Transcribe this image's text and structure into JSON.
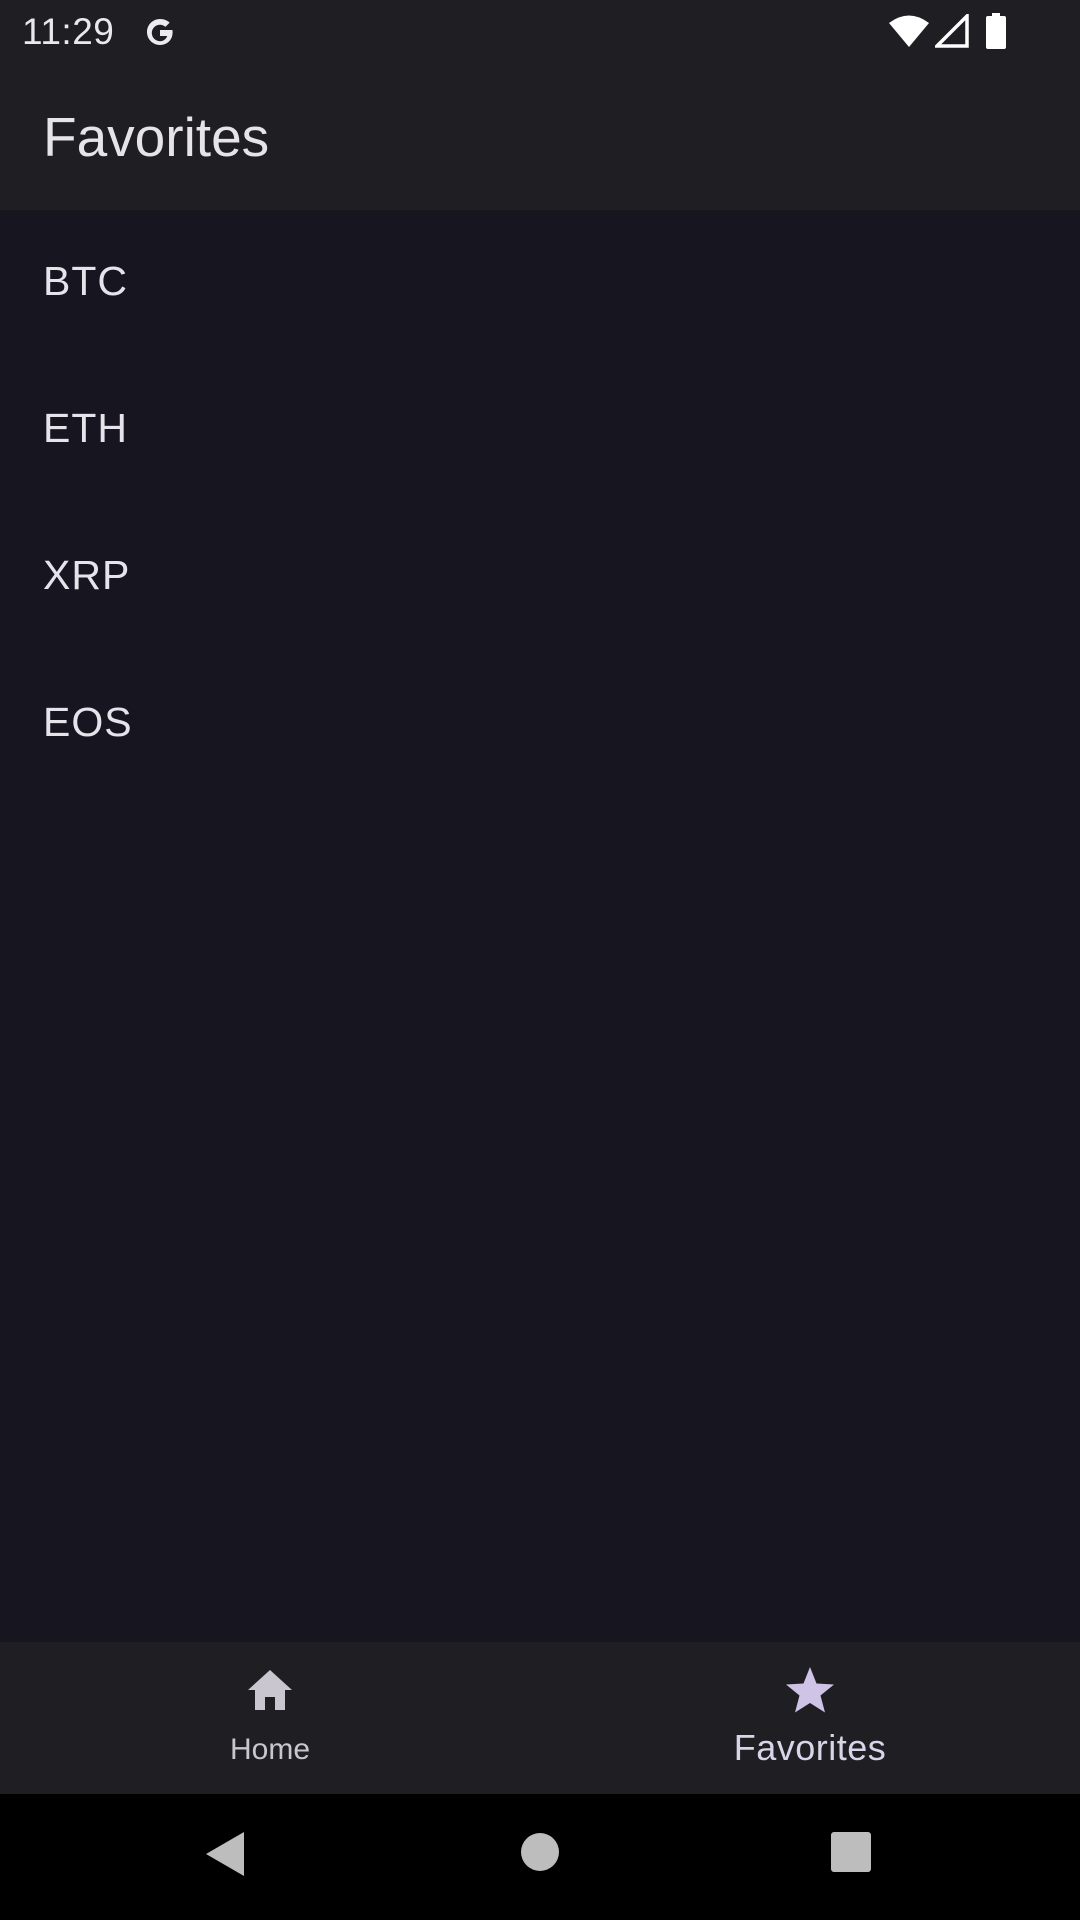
{
  "status_bar": {
    "time": "11:29",
    "icons": [
      "google-g-icon",
      "wifi-icon",
      "signal-icon",
      "battery-icon"
    ]
  },
  "app_bar": {
    "title": "Favorites"
  },
  "favorites": {
    "items": [
      {
        "label": "BTC"
      },
      {
        "label": "ETH"
      },
      {
        "label": "XRP"
      },
      {
        "label": "EOS"
      }
    ]
  },
  "bottom_nav": {
    "items": [
      {
        "label": "Home",
        "icon": "home-icon",
        "selected": false
      },
      {
        "label": "Favorites",
        "icon": "star-icon",
        "selected": true
      }
    ]
  },
  "system_nav": {
    "icons": [
      "back-icon",
      "home-circle-icon",
      "recents-icon"
    ]
  },
  "colors": {
    "background": "#171620",
    "bar_surface": "#1e1e23",
    "text_primary": "#e6e4ea",
    "nav_inactive": "#c9c6d0",
    "nav_active_icon": "#cfc3e6",
    "system_nav": "#000000"
  }
}
